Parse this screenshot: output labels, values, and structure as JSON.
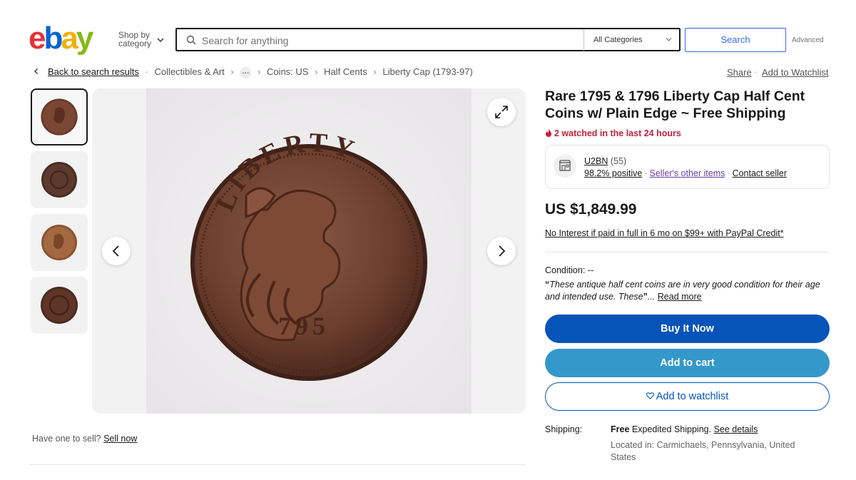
{
  "header": {
    "logo_letters": [
      "e",
      "b",
      "a",
      "y"
    ],
    "logo_colors": [
      "#e53238",
      "#0064d2",
      "#f5af02",
      "#86b817"
    ],
    "shop_by_line1": "Shop by",
    "shop_by_line2": "category",
    "search_placeholder": "Search for anything",
    "category_select": "All Categories",
    "search_button": "Search",
    "advanced": "Advanced"
  },
  "breadcrumb": {
    "back": "Back to search results",
    "items": [
      "Collectibles & Art",
      "Coins: US",
      "Half Cents",
      "Liberty Cap (1793-97)"
    ],
    "more": "...",
    "share": "Share",
    "add_to_watchlist": "Add to Watchlist"
  },
  "gallery": {
    "thumbnail_count": 4,
    "selected_index": 0,
    "coin_inscription": "LIBERTY",
    "coin_date": "795"
  },
  "sell": {
    "question": "Have one to sell?",
    "link": "Sell now"
  },
  "listing": {
    "title": "Rare 1795 & 1796 Liberty Cap Half Cent Coins w/ Plain Edge ~ Free Shipping",
    "watched": "2 watched in the last 24 hours",
    "seller": {
      "name": "U2BN",
      "feedback_count": "(55)",
      "positive": "98.2% positive",
      "other_items": "Seller's other items",
      "contact": "Contact seller"
    },
    "price": "US $1,849.99",
    "credit_offer": "No Interest if paid in full in 6 mo on $99+ with PayPal Credit*",
    "condition_label": "Condition:",
    "condition_value": "--",
    "condition_quote": "These antique half cent coins are in very good condition for their age and intended use. These",
    "read_more": "Read more",
    "buttons": {
      "buy_now": "Buy It Now",
      "add_to_cart": "Add to cart",
      "add_to_watchlist": "Add to watchlist"
    },
    "shipping": {
      "label": "Shipping:",
      "free": "Free",
      "method": "Expedited Shipping.",
      "details": "See details",
      "location": "Located in: Carmichaels, Pennsylvania, United States"
    }
  },
  "colors": {
    "buy_now": "#0654ba",
    "add_to_cart": "#3498ca",
    "watched": "#c3203b",
    "search_btn": "#3665f3"
  }
}
